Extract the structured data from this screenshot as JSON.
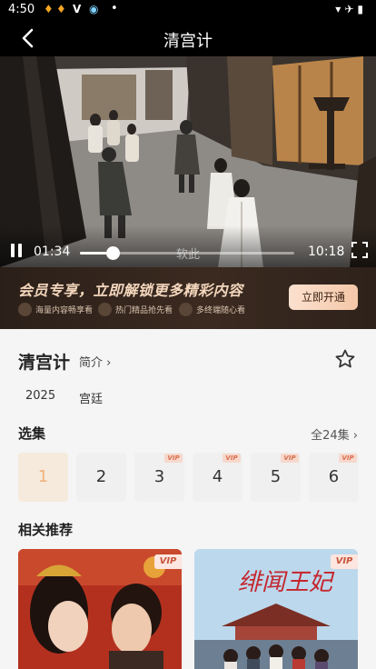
{
  "status": {
    "time": "4:50",
    "dot": "•"
  },
  "header": {
    "title": "清宫计"
  },
  "player": {
    "current_time": "01:34",
    "total_time": "10:18",
    "progress": 0.152,
    "subtitle": "软此"
  },
  "vip_banner": {
    "headline": "会员专享，立即解锁更多精彩内容",
    "perks": [
      "海量内容畅享看",
      "热门精品抢先看",
      "多终端随心看"
    ],
    "button": "立即开通"
  },
  "show": {
    "title": "清宫计",
    "intro_label": "简介",
    "intro_chevron": "›",
    "tags": [
      "2025",
      "宫廷"
    ]
  },
  "episodes": {
    "section_title": "选集",
    "all_label": "全24集",
    "all_chevron": "›",
    "items": [
      {
        "label": "1",
        "vip": false,
        "active": true
      },
      {
        "label": "2",
        "vip": false,
        "active": false
      },
      {
        "label": "3",
        "vip": true,
        "active": false
      },
      {
        "label": "4",
        "vip": true,
        "active": false
      },
      {
        "label": "5",
        "vip": true,
        "active": false
      },
      {
        "label": "6",
        "vip": true,
        "active": false
      }
    ],
    "vip_badge": "VIP"
  },
  "recommend": {
    "section_title": "相关推荐",
    "items": [
      {
        "vip_badge": "VIP"
      },
      {
        "title_art": "绯闻王妃",
        "vip_badge": "VIP"
      }
    ]
  }
}
